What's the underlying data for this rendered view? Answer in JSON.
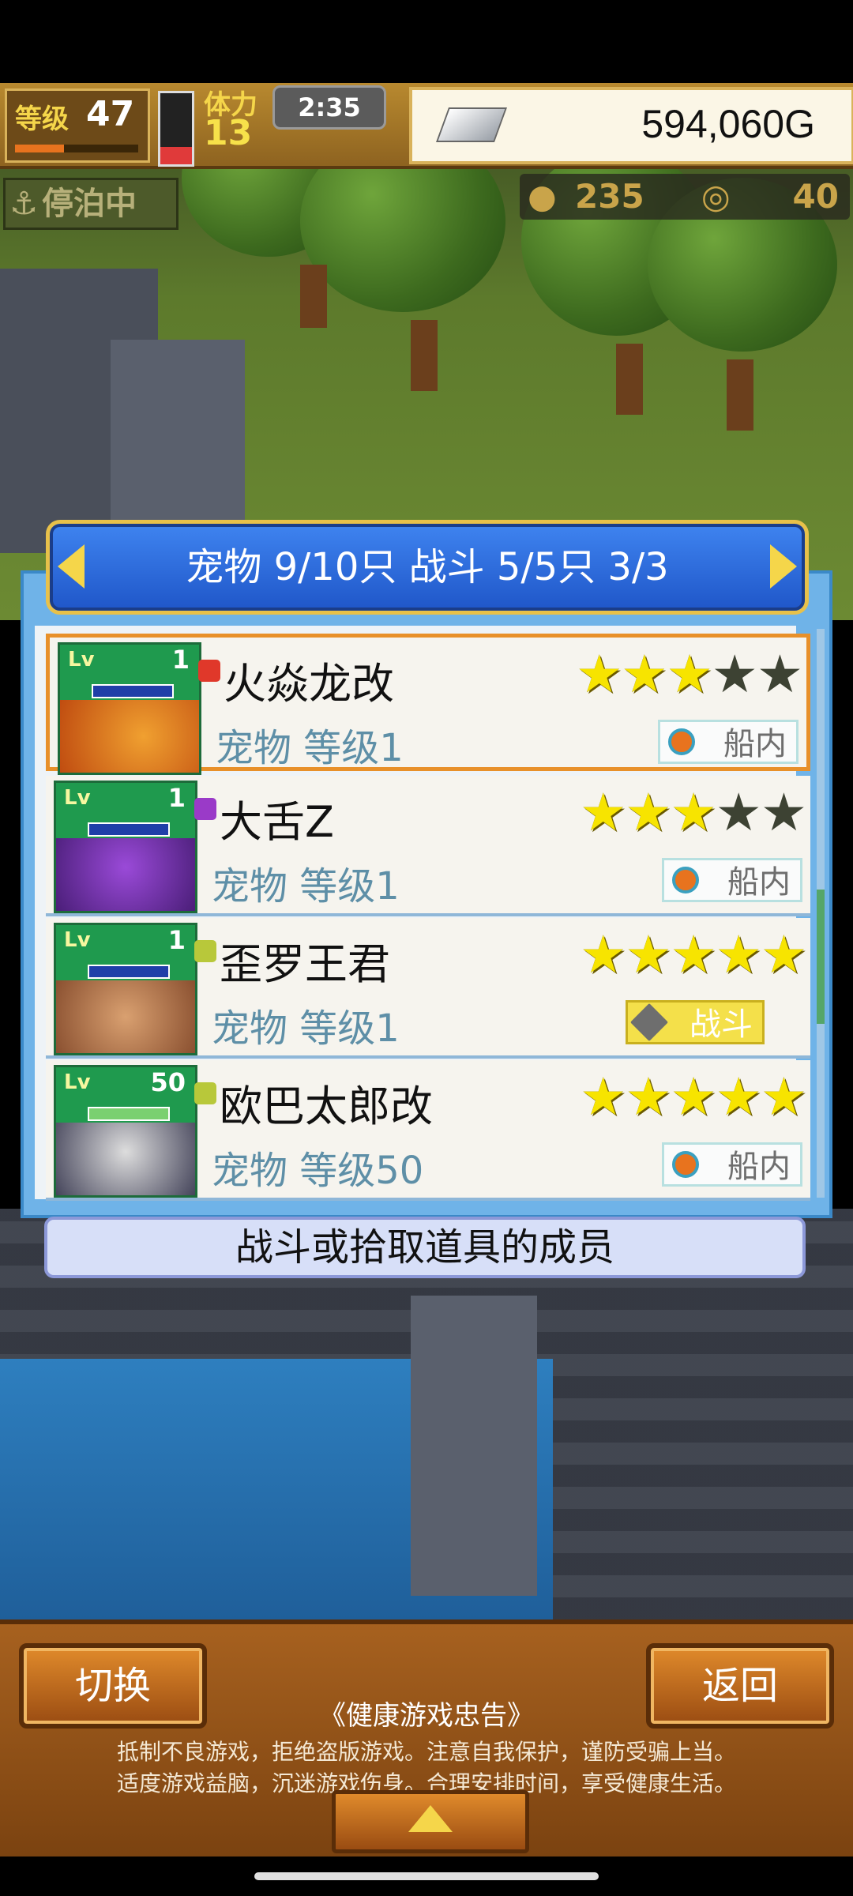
{
  "hud": {
    "level_label": "等级",
    "level_value": "47",
    "stamina_label": "体力",
    "stamina_value": "13",
    "timer": "2:35",
    "gold": "594,060G",
    "dock_status": "停泊中",
    "resource_1": "235",
    "resource_2": "40"
  },
  "panel": {
    "header": "宠物 9/10只 战斗 5/5只 3/3",
    "hint": "战斗或拾取道具的成员"
  },
  "pets": [
    {
      "lv_label": "Lv",
      "level": "1",
      "name": "火焱龙改",
      "subtitle": "宠物 等级1",
      "stars": 3,
      "tag": "船内",
      "element_color": "#e0382a",
      "art_color": "#e07a1e"
    },
    {
      "lv_label": "Lv",
      "level": "1",
      "name": "大舌Z",
      "subtitle": "宠物 等级1",
      "stars": 3,
      "tag": "船内",
      "element_color": "#9a3ac8",
      "art_color": "#6a2ea8"
    },
    {
      "lv_label": "Lv",
      "level": "1",
      "name": "歪罗王君",
      "subtitle": "宠物 等级1",
      "stars": 5,
      "tag": "战斗",
      "element_color": "#b8c83a",
      "art_color": "#b07050"
    },
    {
      "lv_label": "Lv",
      "level": "50",
      "name": "欧巴太郎改",
      "subtitle": "宠物 等级50",
      "stars": 5,
      "tag": "船内",
      "element_color": "#b8c83a",
      "art_color": "#7a7a8a"
    }
  ],
  "bottom": {
    "switch_label": "切换",
    "back_label": "返回",
    "notice_title": "《健康游戏忠告》",
    "notice_line1": "抵制不良游戏，拒绝盗版游戏。注意自我保护，谨防受骗上当。",
    "notice_line2": "适度游戏益脑，沉迷游戏伤身。合理安排时间，享受健康生活。"
  },
  "colors": {
    "accent_orange": "#e8902a",
    "header_blue": "#2f6fe0",
    "subtitle_teal": "#5e8fa7",
    "star_yellow": "#f7e400"
  }
}
